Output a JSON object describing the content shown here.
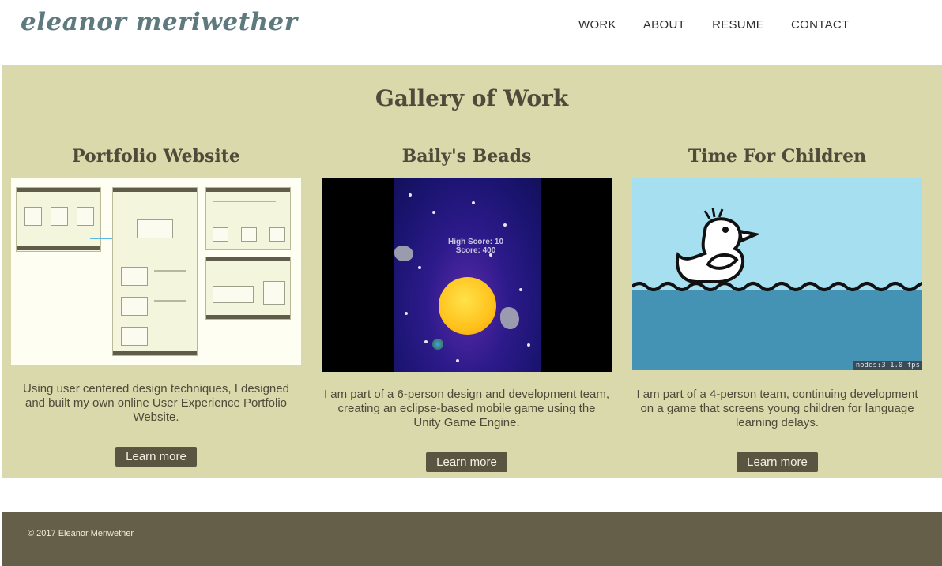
{
  "header": {
    "logo": "eleanor meriwether",
    "nav": [
      "WORK",
      "ABOUT",
      "RESUME",
      "CONTACT"
    ]
  },
  "gallery": {
    "title": "Gallery of Work",
    "cards": [
      {
        "title": "Portfolio Website",
        "description": "Using user centered design techniques, I designed and built my own online User Experience Portfolio Website.",
        "button": "Learn more"
      },
      {
        "title": "Baily's Beads",
        "description": "I am part of a 6-person design and development team, creating an eclipse-based mobile game using the Unity Game Engine.",
        "button": "Learn more",
        "game_score_text": "High Score: 10",
        "game_score_text2": "Score: 400"
      },
      {
        "title": "Time For Children",
        "description": "I am part of a 4-person team, continuing development on a game that screens young children for language learning delays.",
        "button": "Learn more",
        "hud_text": "nodes:3  1.0 fps"
      }
    ]
  },
  "footer": {
    "copyright": "© 2017 Eleanor Meriwether"
  },
  "colors": {
    "gallery_bg": "#d9d9ab",
    "button_bg": "#5a5540",
    "footer_bg": "#655e48",
    "logo": "#5f7a7f"
  }
}
